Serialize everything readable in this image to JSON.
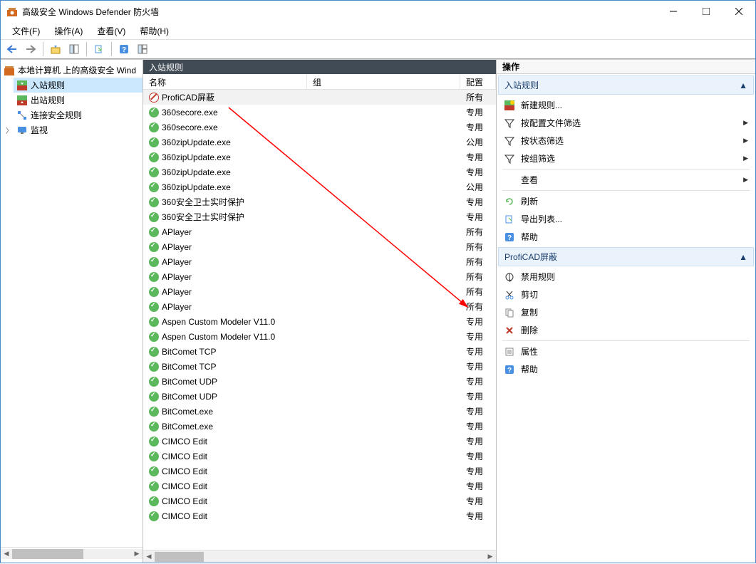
{
  "window": {
    "title": "高级安全 Windows Defender 防火墙"
  },
  "menu": {
    "file": "文件(F)",
    "action": "操作(A)",
    "view": "查看(V)",
    "help": "帮助(H)"
  },
  "tree": {
    "root": "本地计算机 上的高级安全 Wind",
    "inbound": "入站规则",
    "outbound": "出站规则",
    "connsec": "连接安全规则",
    "monitor": "监视"
  },
  "center": {
    "title": "入站规则",
    "col_name": "名称",
    "col_group": "组",
    "col_profile": "配置文件",
    "rows": [
      {
        "icon": "block",
        "name": "ProfiCAD屏蔽",
        "profile": "所有",
        "sel": true
      },
      {
        "icon": "allow",
        "name": "360secore.exe",
        "profile": "专用"
      },
      {
        "icon": "allow",
        "name": "360secore.exe",
        "profile": "专用"
      },
      {
        "icon": "allow",
        "name": "360zipUpdate.exe",
        "profile": "公用"
      },
      {
        "icon": "allow",
        "name": "360zipUpdate.exe",
        "profile": "专用"
      },
      {
        "icon": "allow",
        "name": "360zipUpdate.exe",
        "profile": "专用"
      },
      {
        "icon": "allow",
        "name": "360zipUpdate.exe",
        "profile": "公用"
      },
      {
        "icon": "allow",
        "name": "360安全卫士实时保护",
        "profile": "专用"
      },
      {
        "icon": "allow",
        "name": "360安全卫士实时保护",
        "profile": "专用"
      },
      {
        "icon": "allow",
        "name": "APlayer",
        "profile": "所有"
      },
      {
        "icon": "allow",
        "name": "APlayer",
        "profile": "所有"
      },
      {
        "icon": "allow",
        "name": "APlayer",
        "profile": "所有"
      },
      {
        "icon": "allow",
        "name": "APlayer",
        "profile": "所有"
      },
      {
        "icon": "allow",
        "name": "APlayer",
        "profile": "所有"
      },
      {
        "icon": "allow",
        "name": "APlayer",
        "profile": "所有"
      },
      {
        "icon": "allow",
        "name": "Aspen Custom Modeler V11.0",
        "profile": "专用"
      },
      {
        "icon": "allow",
        "name": "Aspen Custom Modeler V11.0",
        "profile": "专用"
      },
      {
        "icon": "allow",
        "name": "BitComet TCP",
        "profile": "专用"
      },
      {
        "icon": "allow",
        "name": "BitComet TCP",
        "profile": "专用"
      },
      {
        "icon": "allow",
        "name": "BitComet UDP",
        "profile": "专用"
      },
      {
        "icon": "allow",
        "name": "BitComet UDP",
        "profile": "专用"
      },
      {
        "icon": "allow",
        "name": "BitComet.exe",
        "profile": "专用"
      },
      {
        "icon": "allow",
        "name": "BitComet.exe",
        "profile": "专用"
      },
      {
        "icon": "allow",
        "name": "CIMCO Edit",
        "profile": "专用"
      },
      {
        "icon": "allow",
        "name": "CIMCO Edit",
        "profile": "专用"
      },
      {
        "icon": "allow",
        "name": "CIMCO Edit",
        "profile": "专用"
      },
      {
        "icon": "allow",
        "name": "CIMCO Edit",
        "profile": "专用"
      },
      {
        "icon": "allow",
        "name": "CIMCO Edit",
        "profile": "专用"
      },
      {
        "icon": "allow",
        "name": "CIMCO Edit",
        "profile": "专用"
      }
    ]
  },
  "actions": {
    "title": "操作",
    "section1": "入站规则",
    "new_rule": "新建规则...",
    "filter_profile": "按配置文件筛选",
    "filter_state": "按状态筛选",
    "filter_group": "按组筛选",
    "view": "查看",
    "refresh": "刷新",
    "export": "导出列表...",
    "help1": "帮助",
    "section2": "ProfiCAD屏蔽",
    "disable": "禁用规则",
    "cut": "剪切",
    "copy": "复制",
    "delete": "删除",
    "properties": "属性",
    "help2": "帮助"
  }
}
